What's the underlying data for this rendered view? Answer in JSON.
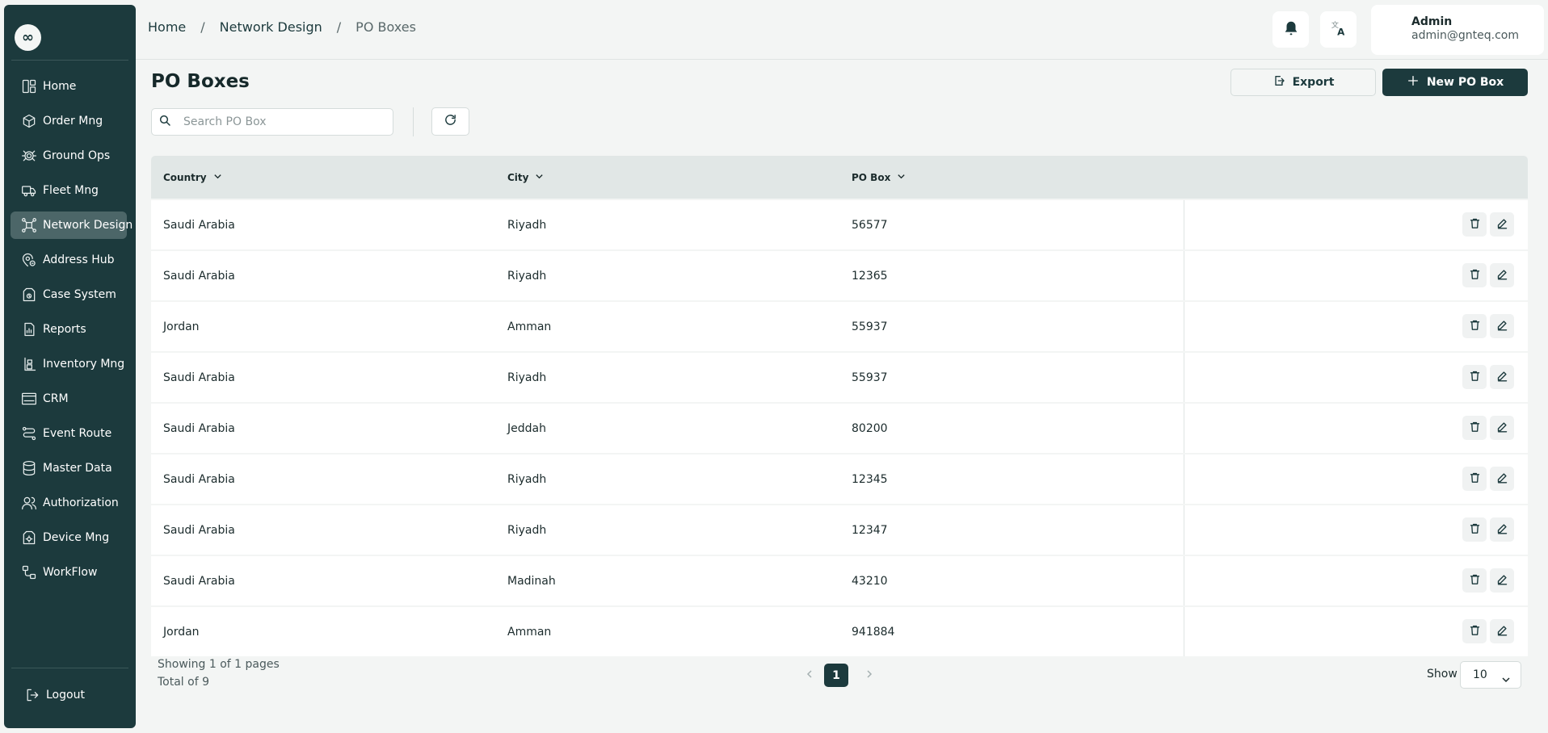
{
  "sidebar": {
    "logo": "∞",
    "items": [
      {
        "label": "Home",
        "icon": "layout-grid-icon"
      },
      {
        "label": "Order Mng",
        "icon": "package-icon"
      },
      {
        "label": "Ground Ops",
        "icon": "radar-icon"
      },
      {
        "label": "Fleet Mng",
        "icon": "truck-icon"
      },
      {
        "label": "Network Design",
        "icon": "network-icon",
        "active": true
      },
      {
        "label": "Address Hub",
        "icon": "map-pin-icon"
      },
      {
        "label": "Case System",
        "icon": "case-icon"
      },
      {
        "label": "Reports",
        "icon": "report-icon"
      },
      {
        "label": "Inventory Mng",
        "icon": "inventory-icon"
      },
      {
        "label": "CRM",
        "icon": "crm-icon"
      },
      {
        "label": "Event Route",
        "icon": "route-icon"
      },
      {
        "label": "Master Data",
        "icon": "database-icon"
      },
      {
        "label": "Authorization",
        "icon": "users-icon"
      },
      {
        "label": "Device Mng",
        "icon": "device-gear-icon"
      },
      {
        "label": "WorkFlow",
        "icon": "workflow-icon"
      }
    ],
    "logout_label": "Logout"
  },
  "header": {
    "breadcrumb": [
      "Home",
      "Network Design",
      "PO Boxes"
    ],
    "user": {
      "name": "Admin",
      "email": "admin@gnteq.com"
    }
  },
  "page": {
    "title": "PO Boxes",
    "export_label": "Export",
    "new_label": "New PO Box",
    "search_placeholder": "Search PO Box"
  },
  "table": {
    "columns": [
      "Country",
      "City",
      "PO Box"
    ],
    "rows": [
      {
        "country": "Saudi Arabia",
        "city": "Riyadh",
        "po_box": "56577"
      },
      {
        "country": "Saudi Arabia",
        "city": "Riyadh",
        "po_box": "12365"
      },
      {
        "country": "Jordan",
        "city": "Amman",
        "po_box": "55937"
      },
      {
        "country": "Saudi Arabia",
        "city": "Riyadh",
        "po_box": "55937"
      },
      {
        "country": "Saudi Arabia",
        "city": "Jeddah",
        "po_box": "80200"
      },
      {
        "country": "Saudi Arabia",
        "city": "Riyadh",
        "po_box": "12345"
      },
      {
        "country": "Saudi Arabia",
        "city": "Riyadh",
        "po_box": "12347"
      },
      {
        "country": "Saudi Arabia",
        "city": "Madinah",
        "po_box": "43210"
      },
      {
        "country": "Jordan",
        "city": "Amman",
        "po_box": "941884"
      }
    ]
  },
  "pagination": {
    "showing": "Showing 1 of 1 pages",
    "total": "Total of 9",
    "current_page": "1",
    "show_label": "Show",
    "page_size": "10"
  },
  "colors": {
    "sidebar_bg": "#1c3a3d",
    "sidebar_active": "#4c6668",
    "primary": "#1c3a3d",
    "page_bg": "#f3f5f4",
    "table_header_bg": "#e1e7e6"
  }
}
